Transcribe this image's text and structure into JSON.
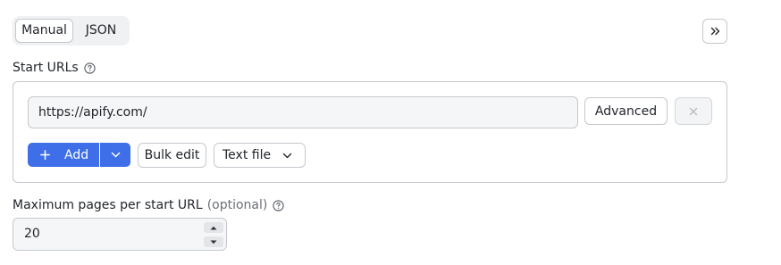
{
  "mode_toggle": {
    "tabs": [
      {
        "label": "Manual",
        "selected": true
      },
      {
        "label": "JSON",
        "selected": false
      }
    ]
  },
  "start_urls": {
    "label": "Start URLs",
    "url_value": "https://apify.com/",
    "advanced_label": "Advanced",
    "add_label": "Add",
    "bulk_edit_label": "Bulk edit",
    "text_file_label": "Text file"
  },
  "max_pages": {
    "label": "Maximum pages per start URL",
    "optional_label": "(optional)",
    "value": "20"
  },
  "colors": {
    "accent": "#3e6ee8",
    "border": "#c5c8ce",
    "input_bg": "#f5f6f7"
  }
}
